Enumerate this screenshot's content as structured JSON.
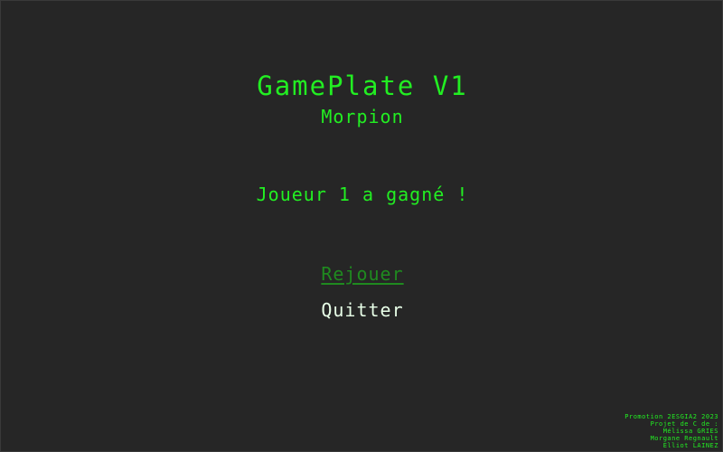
{
  "game": {
    "title": "GamePlate V1",
    "subtitle": "Morpion",
    "result_message": "Joueur 1 a gagné !"
  },
  "menu": {
    "items": [
      {
        "label": "Rejouer",
        "state": "selected"
      },
      {
        "label": "Quitter",
        "state": "normal"
      }
    ]
  },
  "credits": {
    "lines": [
      "Promotion 2ESGIA2 2023",
      "Projet de C de :",
      "Mélissa GRIES",
      "Morgane Regnault",
      "Elliot LAINEZ"
    ]
  },
  "colors": {
    "background": "#262626",
    "text_green": "#22ee22",
    "selected_green": "#1f8a1f",
    "menu_white": "#e8ffe8"
  }
}
